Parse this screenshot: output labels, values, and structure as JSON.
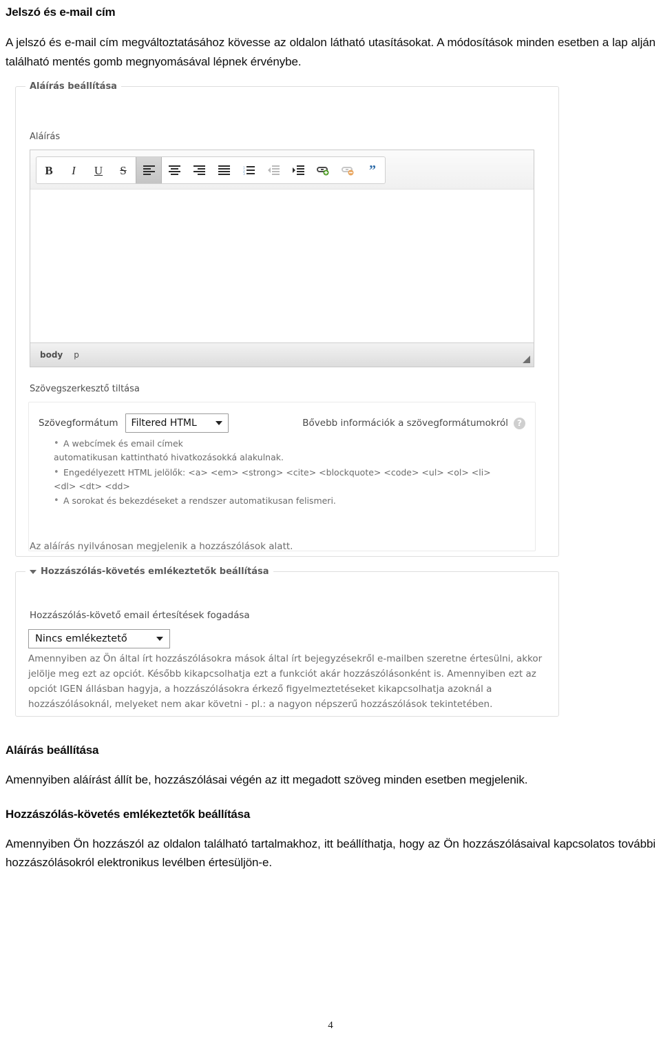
{
  "document": {
    "heading_top": "Jelszó és e-mail cím",
    "intro_paragraph": "A jelszó és e-mail cím megváltoztatásához kövesse az oldalon látható utasításokat. A módosítások minden esetben a lap alján található mentés gomb megnyomásával lépnek érvénybe.",
    "heading_signature": "Aláírás beállítása",
    "paragraph_signature": "Amennyiben aláírást állít be, hozzászólásai végén az itt megadott szöveg minden esetben megjelenik.",
    "heading_comments": "Hozzászólás-követés emlékeztetők beállítása",
    "paragraph_comments": "Amennyiben Ön hozzászól az oldalon található tartalmakhoz, itt beállíthatja, hogy az Ön hozzászólásaival kapcsolatos további hozzászólásokról elektronikus levélben értesüljön-e.",
    "page_number": "4"
  },
  "screenshot": {
    "signature_panel": {
      "legend": "Aláírás beállítása",
      "field_label": "Aláírás",
      "toolbar": [
        {
          "name": "bold-icon",
          "glyph": "B",
          "style": "bold",
          "active": false
        },
        {
          "name": "italic-icon",
          "glyph": "I",
          "style": "italic",
          "active": false
        },
        {
          "name": "underline-icon",
          "glyph": "U",
          "style": "underline",
          "active": false
        },
        {
          "name": "strikethrough-icon",
          "glyph": "S",
          "style": "strike",
          "active": false
        },
        {
          "name": "align-left-icon",
          "glyph": "align-left",
          "style": "svg",
          "active": true
        },
        {
          "name": "align-center-icon",
          "glyph": "align-center",
          "style": "svg",
          "active": false
        },
        {
          "name": "align-right-icon",
          "glyph": "align-right",
          "style": "svg",
          "active": false
        },
        {
          "name": "align-justify-icon",
          "glyph": "align-justify",
          "style": "svg",
          "active": false
        },
        {
          "name": "numbered-list-icon",
          "glyph": "numbered-list",
          "style": "svg",
          "active": false
        },
        {
          "name": "outdent-icon",
          "glyph": "outdent",
          "style": "svg",
          "active": false
        },
        {
          "name": "indent-icon",
          "glyph": "indent",
          "style": "svg",
          "active": false
        },
        {
          "name": "add-link-icon",
          "glyph": "add-link",
          "style": "svg",
          "active": false
        },
        {
          "name": "remove-link-icon",
          "glyph": "remove-link",
          "style": "svg",
          "active": false
        },
        {
          "name": "blockquote-icon",
          "glyph": "blockquote",
          "style": "svg",
          "active": false
        }
      ],
      "editor_content": "",
      "statusbar": {
        "element_path_root": "body",
        "element_path_current": "p"
      },
      "toggle_editor_label": "Szövegszerkesztő tiltása",
      "format_label": "Szövegformátum",
      "format_value": "Filtered HTML",
      "format_help_label": "Bővebb információk a szövegformátumokról",
      "help_icon_glyph": "?",
      "format_tips": [
        {
          "line1": "A webcímek és email címek",
          "line2": "automatikusan kattintható hivatkozásokká alakulnak."
        },
        {
          "line1": "Engedélyezett HTML jelölők: <a> <em> <strong> <cite> <blockquote> <code> <ul> <ol> <li>",
          "line2": "<dl> <dt> <dd>"
        },
        {
          "line1": "A sorokat és bekezdéseket a rendszer automatikusan felismeri.",
          "line2": ""
        }
      ],
      "signature_note": "Az aláírás nyilvánosan megjelenik a hozzászólások alatt."
    },
    "comments_panel": {
      "legend": "Hozzászólás-követés emlékeztetők beállítása",
      "field_label": "Hozzászólás-követő email értesítések fogadása",
      "reminder_value": "Nincs emlékeztető",
      "description": "Amennyiben az Ön által írt hozzászólásokra mások által írt bejegyzésekről e-mailben szeretne értesülni, akkor jelölje meg ezt az opciót. Később kikapcsolhatja ezt a funkciót akár hozzászólásonként is. Amennyiben ezt az opciót IGEN állásban hagyja, a hozzászólásokra érkező figyelmeztetéseket kikapcsolhatja azoknál a hozzászólásoknál, melyeket nem akar követni - pl.: a nagyon népszerű hozzászólások tekintetében."
    }
  },
  "colors": {
    "page_background": "#ffffff",
    "panel_border": "#dedede",
    "toolbar_active": "#c4c4c4",
    "add_link_accent": "#4a9a20",
    "remove_link_accent": "#e8a45c",
    "blockquote_accent": "#2f6ca8",
    "list_marker_accent": "#6f9bc4"
  }
}
